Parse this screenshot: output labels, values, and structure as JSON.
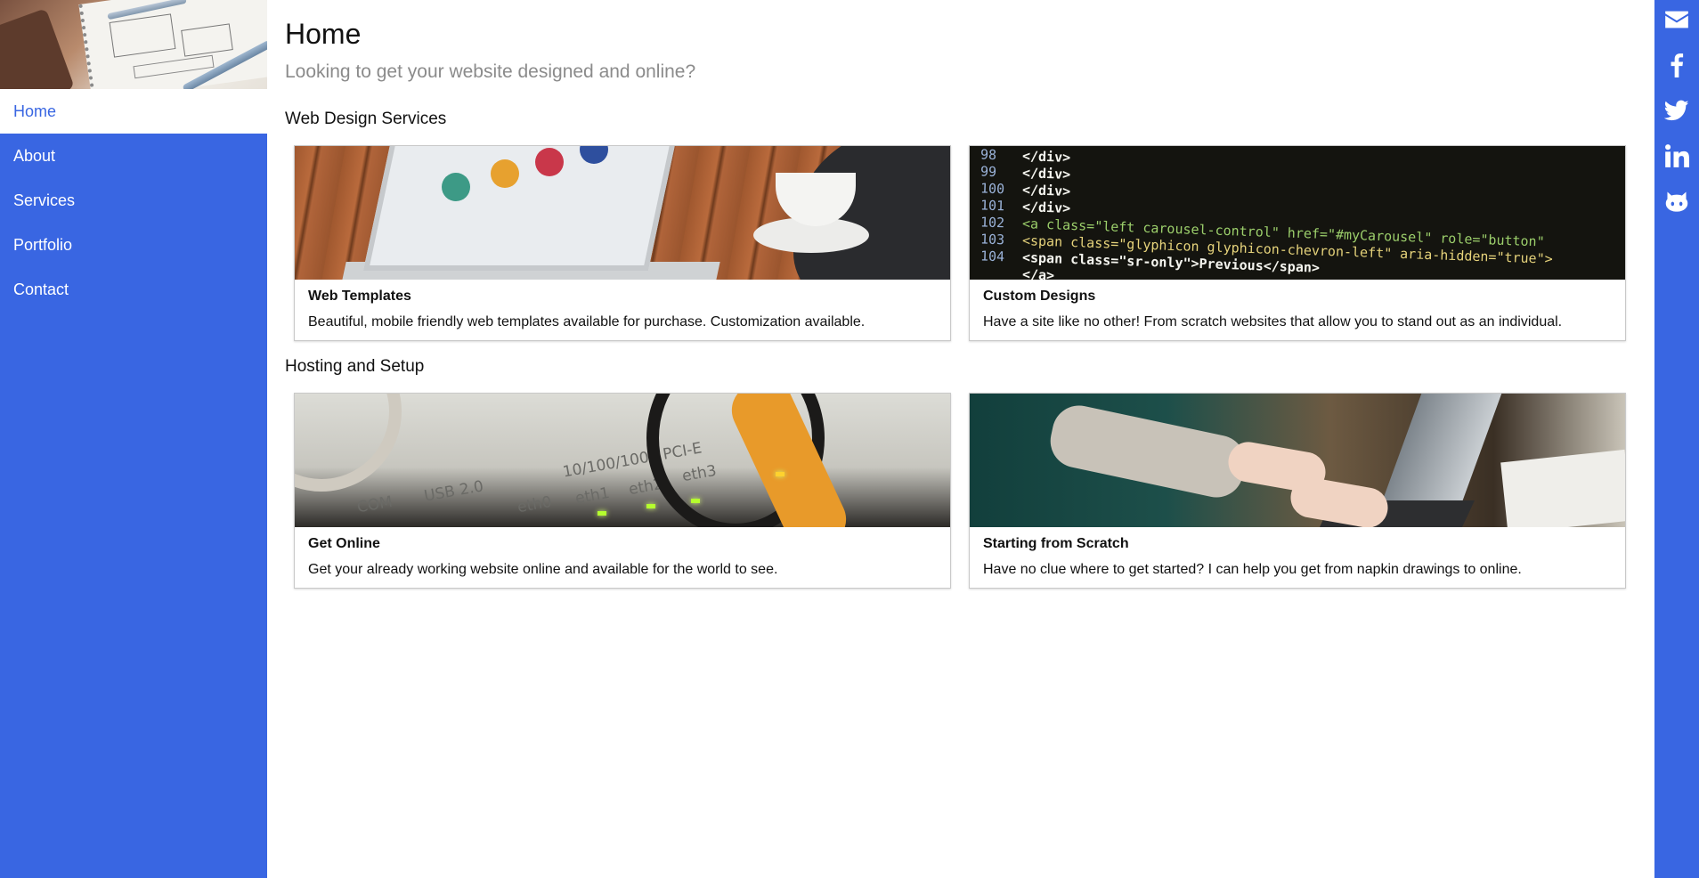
{
  "sidebar": {
    "items": [
      {
        "label": "Home",
        "active": true
      },
      {
        "label": "About",
        "active": false
      },
      {
        "label": "Services",
        "active": false
      },
      {
        "label": "Portfolio",
        "active": false
      },
      {
        "label": "Contact",
        "active": false
      }
    ]
  },
  "social": {
    "icons": [
      "envelope-icon",
      "facebook-icon",
      "twitter-icon",
      "linkedin-icon",
      "github-icon"
    ]
  },
  "page": {
    "title": "Home",
    "subtitle": "Looking to get your website designed and online?"
  },
  "sections": [
    {
      "title": "Web Design Services",
      "cards": [
        {
          "title": "Web Templates",
          "text": "Beautiful, mobile friendly web templates available for purchase. Customization available."
        },
        {
          "title": "Custom Designs",
          "text": "Have a site like no other! From scratch websites that allow you to stand out as an individual."
        }
      ]
    },
    {
      "title": "Hosting and Setup",
      "cards": [
        {
          "title": "Get Online",
          "text": "Get your already working website online and available for the world to see."
        },
        {
          "title": "Starting from Scratch",
          "text": "Have no clue where to get started? I can help you get from napkin drawings to online."
        }
      ]
    }
  ],
  "code_image": {
    "lines": [
      {
        "num": "98",
        "code": "        </div>"
      },
      {
        "num": "99",
        "code": "      </div>"
      },
      {
        "num": "100",
        "code": "    </div>"
      },
      {
        "num": "101",
        "code": "  </div>"
      },
      {
        "num": "102",
        "code": "  <a class=\"left carousel-control\" href=\"#myCarousel\" role=\"button\""
      },
      {
        "num": "103",
        "code": "    <span class=\"glyphicon glyphicon-chevron-left\" aria-hidden=\"true\">"
      },
      {
        "num": "104",
        "code": "    <span class=\"sr-only\">Previous</span>"
      },
      {
        "num": "",
        "code": "  </a>"
      }
    ]
  },
  "network_image": {
    "labels": [
      "10/100/1000 PCI-E",
      "USB 2.0",
      "eth0",
      "eth1",
      "eth2",
      "eth3",
      "COM"
    ]
  },
  "colors": {
    "brand_blue": "#3966e2",
    "subtitle_gray": "#8b8b8b"
  }
}
